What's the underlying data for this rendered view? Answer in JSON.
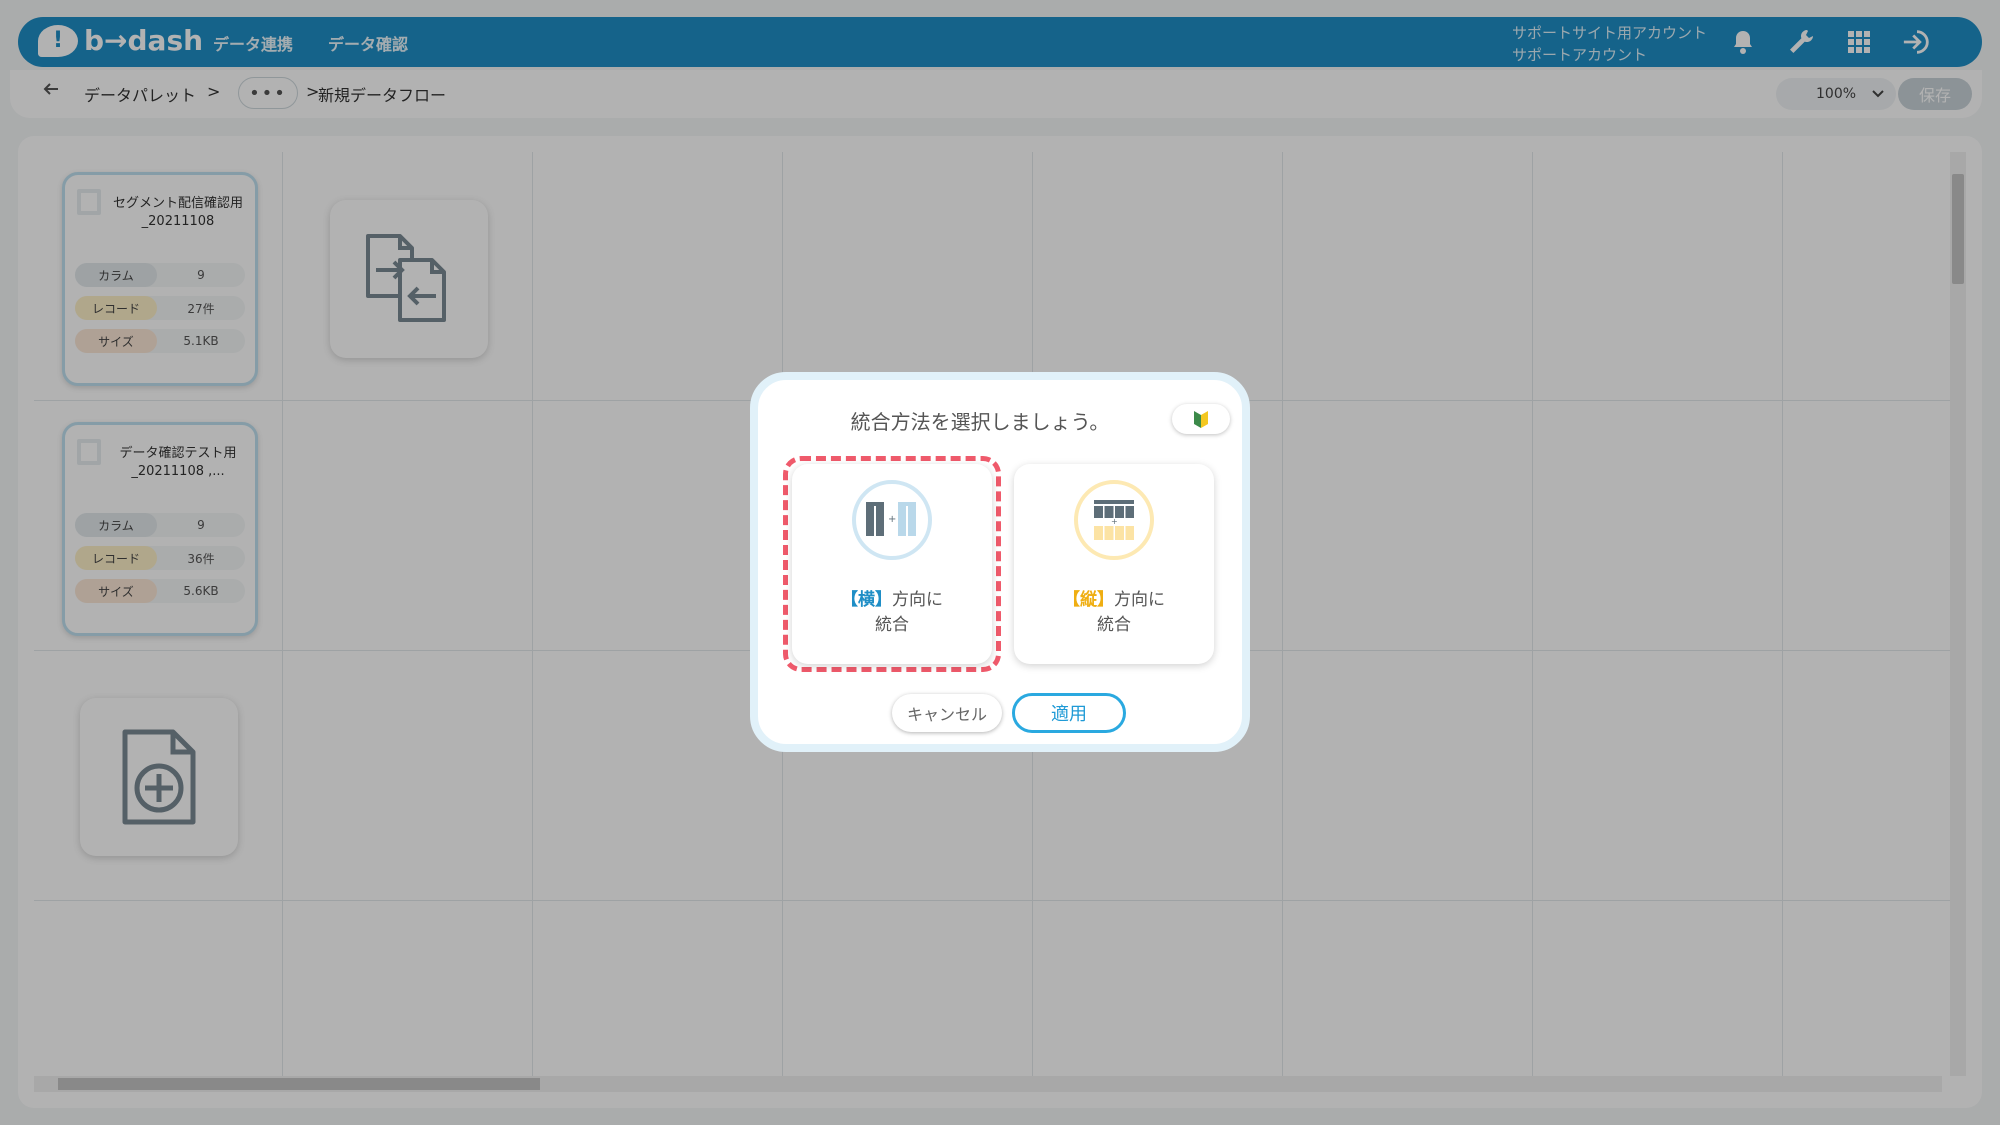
{
  "header": {
    "logo_text": "b→dash",
    "nav": [
      "データ連携",
      "データ確認"
    ],
    "account_line1": "サポートサイト用アカウント",
    "account_line2": "サポートアカウント",
    "icons": [
      "bell-icon",
      "wrench-icon",
      "grid-icon",
      "logout-icon"
    ]
  },
  "breadcrumb": {
    "back_icon": "arrow-left-icon",
    "item1": "データパレット",
    "sep1": ">",
    "more": "•••",
    "sep2": ">",
    "current": "新規データフロー",
    "zoom": "100%",
    "save_label": "保存"
  },
  "cards": [
    {
      "title": "セグメント配信確認用_20211108",
      "rows": [
        {
          "key": "カラム",
          "value": "9"
        },
        {
          "key": "レコード",
          "value": "27件"
        },
        {
          "key": "サイズ",
          "value": "5.1KB"
        }
      ]
    },
    {
      "title": "データ確認テスト用_20211108 ,...",
      "rows": [
        {
          "key": "カラム",
          "value": "9"
        },
        {
          "key": "レコード",
          "value": "36件"
        },
        {
          "key": "サイズ",
          "value": "5.6KB"
        }
      ]
    }
  ],
  "modal": {
    "title": "統合方法を選択しましょう。",
    "beginner_icon": "beginner-mark-icon",
    "option_horizontal": {
      "bracket": "【横】",
      "rest": "方向に",
      "line2": "統合"
    },
    "option_vertical": {
      "bracket": "【縦】",
      "rest": "方向に",
      "line2": "統合"
    },
    "cancel_label": "キャンセル",
    "apply_label": "適用"
  },
  "colors": {
    "brand": "#1f8ec6",
    "selection": "#ef5a6b",
    "apply": "#2aa9e0",
    "vertical_accent": "#efae12"
  }
}
